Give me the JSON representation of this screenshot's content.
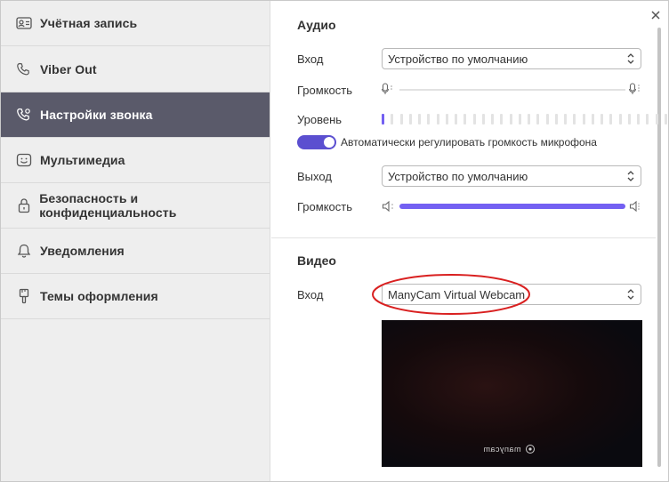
{
  "sidebar": {
    "items": [
      {
        "label": "Учётная запись",
        "icon": "account-card-icon",
        "active": false
      },
      {
        "label": "Viber Out",
        "icon": "phone-icon",
        "active": false
      },
      {
        "label": "Настройки звонка",
        "icon": "phone-settings-icon",
        "active": true
      },
      {
        "label": "Мультимедиа",
        "icon": "smiley-icon",
        "active": false
      },
      {
        "label": "Безопасность и конфиденциальность",
        "icon": "lock-icon",
        "active": false
      },
      {
        "label": "Уведомления",
        "icon": "bell-icon",
        "active": false
      },
      {
        "label": "Темы оформления",
        "icon": "brush-icon",
        "active": false
      }
    ]
  },
  "audio": {
    "title": "Аудио",
    "input_label": "Вход",
    "input_value": "Устройство по умолчанию",
    "volume_label": "Громкость",
    "mic_volume_level": 0,
    "level_label": "Уровень",
    "level_active_bars": 1,
    "level_total_bars": 32,
    "auto_label": "Автоматически регулировать громкость микрофона",
    "auto_enabled": true,
    "output_label": "Выход",
    "output_value": "Устройство по умолчанию",
    "output_volume_label": "Громкость",
    "output_volume_level": 1.0
  },
  "video": {
    "title": "Видео",
    "input_label": "Вход",
    "input_value": "ManyCam Virtual Webcam",
    "watermark": "manycam"
  },
  "colors": {
    "accent": "#7360f2",
    "sidebar_active": "#5a5a6a",
    "annotation": "#d92020"
  }
}
